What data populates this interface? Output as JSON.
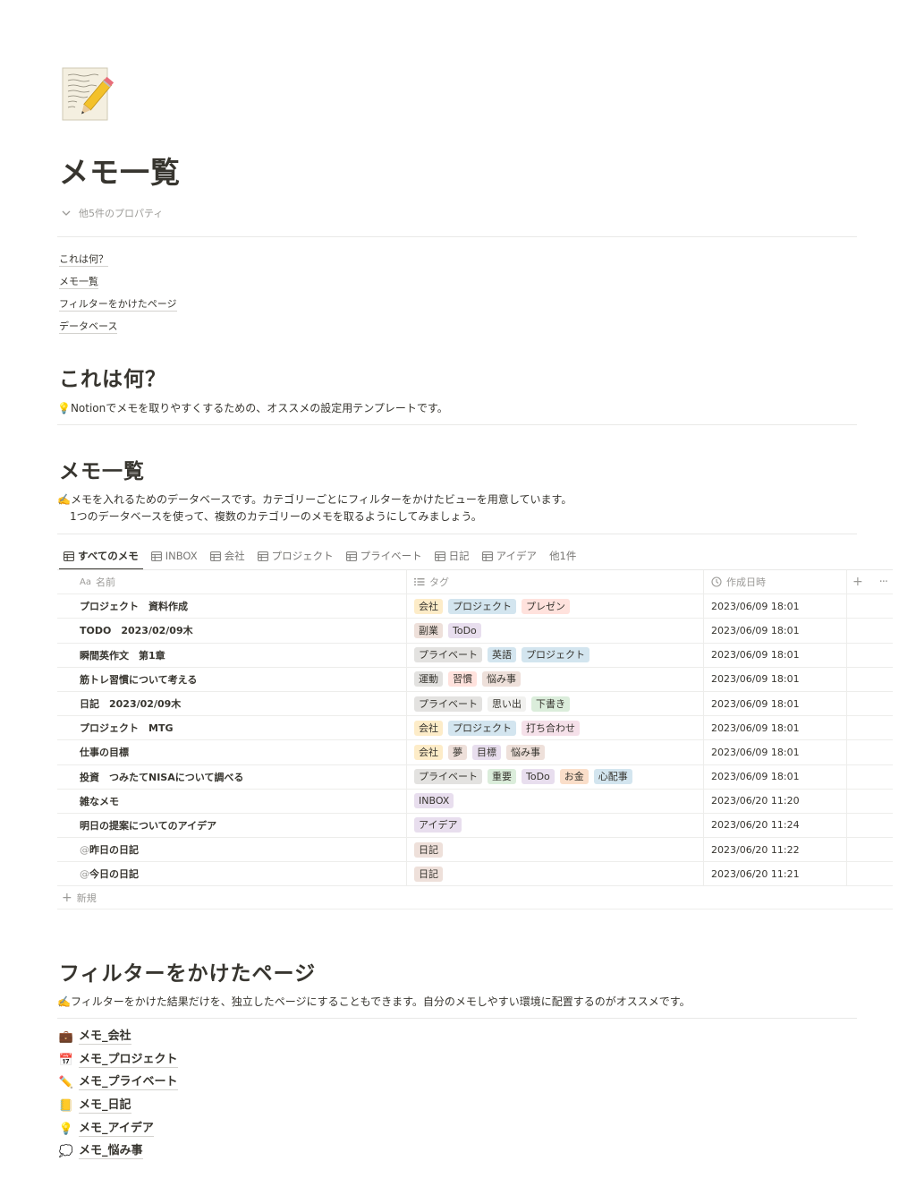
{
  "page": {
    "title": "メモ一覧",
    "props_toggle": "他5件のプロパティ"
  },
  "toc": [
    "これは何？",
    "メモ一覧",
    "フィルターをかけたページ",
    "データベース"
  ],
  "section1": {
    "heading": "これは何？",
    "text": "💡Notionでメモを取りやすくするための、オススメの設定用テンプレートです。"
  },
  "section2": {
    "heading": "メモ一覧",
    "line1": "✍️メモを入れるためのデータベースです。カテゴリーごとにフィルターをかけたビューを用意しています。",
    "line2": "1つのデータベースを使って、複数のカテゴリーのメモを取るようにしてみましょう。"
  },
  "tabs": [
    {
      "label": "すべてのメモ",
      "active": true,
      "icon": "table-icon"
    },
    {
      "label": "INBOX",
      "icon": "table-icon"
    },
    {
      "label": "会社",
      "icon": "table-icon"
    },
    {
      "label": "プロジェクト",
      "icon": "table-icon"
    },
    {
      "label": "プライベート",
      "icon": "table-icon"
    },
    {
      "label": "日記",
      "icon": "table-icon"
    },
    {
      "label": "アイデア",
      "icon": "table-icon"
    },
    {
      "label": "他1件"
    }
  ],
  "table": {
    "headers": {
      "name": "名前",
      "name_prefix": "Aa",
      "tags": "タグ",
      "created": "作成日時"
    },
    "rows": [
      {
        "at": "",
        "name": "プロジェクト　資料作成",
        "tags": [
          {
            "t": "会社",
            "c": "#fdecc8"
          },
          {
            "t": "プロジェクト",
            "c": "#d3e5ef"
          },
          {
            "t": "プレゼン",
            "c": "#ffe2dd"
          }
        ],
        "date": "2023/06/09 18:01"
      },
      {
        "at": "",
        "name": "TODO　2023/02/09木",
        "tags": [
          {
            "t": "副業",
            "c": "#eee0da"
          },
          {
            "t": "ToDo",
            "c": "#e8deee"
          }
        ],
        "date": "2023/06/09 18:01"
      },
      {
        "at": "",
        "name": "瞬間英作文　第1章",
        "tags": [
          {
            "t": "プライベート",
            "c": "#e3e2e0"
          },
          {
            "t": "英語",
            "c": "#d3e5ef"
          },
          {
            "t": "プロジェクト",
            "c": "#d3e5ef"
          }
        ],
        "date": "2023/06/09 18:01"
      },
      {
        "at": "",
        "name": "筋トレ習慣について考える",
        "tags": [
          {
            "t": "運動",
            "c": "#e3e2e0"
          },
          {
            "t": "習慣",
            "c": "#ffe2dd"
          },
          {
            "t": "悩み事",
            "c": "#eee0da"
          }
        ],
        "date": "2023/06/09 18:01"
      },
      {
        "at": "",
        "name": "日記　2023/02/09木",
        "tags": [
          {
            "t": "プライベート",
            "c": "#e3e2e0"
          },
          {
            "t": "思い出",
            "c": "#f1f1ef"
          },
          {
            "t": "下書き",
            "c": "#dbeddb"
          }
        ],
        "date": "2023/06/09 18:01"
      },
      {
        "at": "",
        "name": "プロジェクト　MTG",
        "tags": [
          {
            "t": "会社",
            "c": "#fdecc8"
          },
          {
            "t": "プロジェクト",
            "c": "#d3e5ef"
          },
          {
            "t": "打ち合わせ",
            "c": "#f5e0e9"
          }
        ],
        "date": "2023/06/09 18:01"
      },
      {
        "at": "",
        "name": "仕事の目標",
        "tags": [
          {
            "t": "会社",
            "c": "#fdecc8"
          },
          {
            "t": "夢",
            "c": "#eee0da"
          },
          {
            "t": "目標",
            "c": "#e8deee"
          },
          {
            "t": "悩み事",
            "c": "#eee0da"
          }
        ],
        "date": "2023/06/09 18:01"
      },
      {
        "at": "",
        "name": "投資　つみたてNISAについて調べる",
        "tags": [
          {
            "t": "プライベート",
            "c": "#e3e2e0"
          },
          {
            "t": "重要",
            "c": "#dbeddb"
          },
          {
            "t": "ToDo",
            "c": "#e8deee"
          },
          {
            "t": "お金",
            "c": "#fadec9"
          },
          {
            "t": "心配事",
            "c": "#d3e5ef"
          }
        ],
        "date": "2023/06/09 18:01"
      },
      {
        "at": "",
        "name": "雑なメモ",
        "tags": [
          {
            "t": "INBOX",
            "c": "#e8deee"
          }
        ],
        "date": "2023/06/20 11:20"
      },
      {
        "at": "",
        "name": "明日の提案についてのアイデア",
        "tags": [
          {
            "t": "アイデア",
            "c": "#e8deee"
          }
        ],
        "date": "2023/06/20 11:24"
      },
      {
        "at": "@",
        "name": "昨日の日記",
        "tags": [
          {
            "t": "日記",
            "c": "#eee0da"
          }
        ],
        "date": "2023/06/20 11:22"
      },
      {
        "at": "@",
        "name": "今日の日記",
        "tags": [
          {
            "t": "日記",
            "c": "#eee0da"
          }
        ],
        "date": "2023/06/20 11:21"
      }
    ],
    "new_label": "新規"
  },
  "section3": {
    "heading": "フィルターをかけたページ",
    "text": "✍️フィルターをかけた結果だけを、独立したページにすることもできます。自分のメモしやすい環境に配置するのがオススメです。"
  },
  "linked_pages": [
    {
      "emoji": "💼",
      "icon": "briefcase-icon",
      "label": "メモ_会社"
    },
    {
      "emoji": "📅",
      "icon": "calendar-icon",
      "label": "メモ_プロジェクト"
    },
    {
      "emoji": "✏️",
      "icon": "pencil-icon",
      "label": "メモ_プライベート"
    },
    {
      "emoji": "📒",
      "icon": "notebook-icon",
      "label": "メモ_日記"
    },
    {
      "emoji": "💡",
      "icon": "lightbulb-icon",
      "label": "メモ_アイデア"
    },
    {
      "emoji": "💭",
      "icon": "thought-bubble-icon",
      "label": "メモ_悩み事"
    }
  ]
}
